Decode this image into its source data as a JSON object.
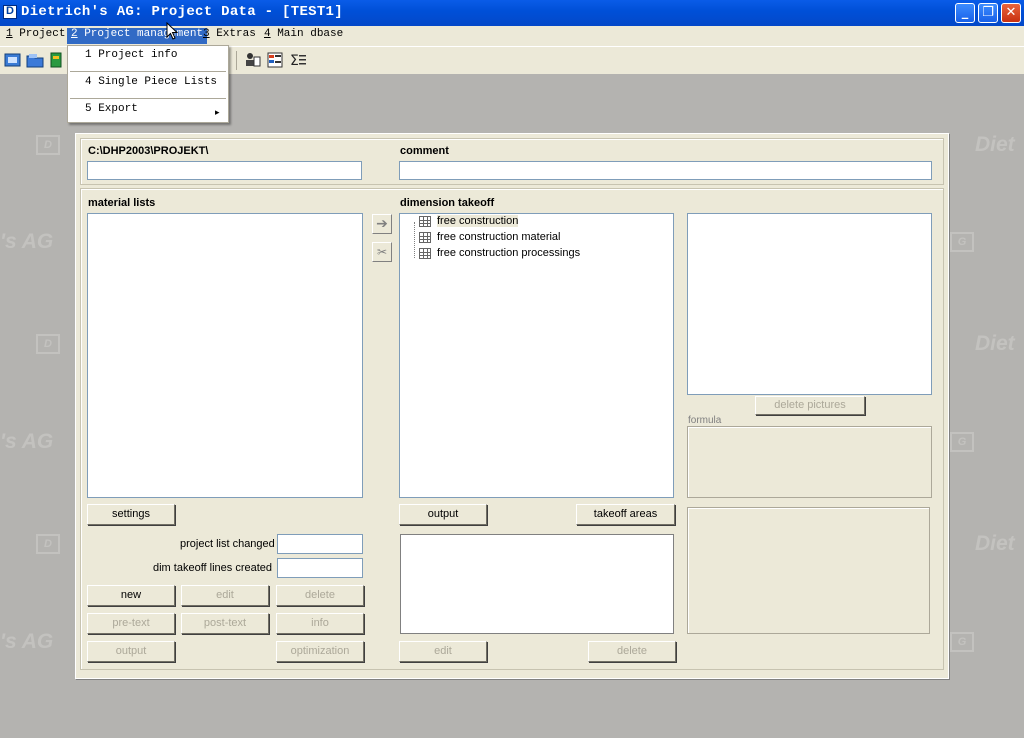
{
  "window": {
    "title": "Dietrich's AG: Project Data - [TEST1]"
  },
  "menubar": {
    "items": [
      {
        "key": "1",
        "label": " Project"
      },
      {
        "key": "2",
        "label": " Project management"
      },
      {
        "key": "3",
        "label": " Extras"
      },
      {
        "key": "4",
        "label": " Main dbase"
      }
    ]
  },
  "dropdown": {
    "items": [
      {
        "label": "1 Project info"
      },
      {
        "label": "4 Single Piece Lists"
      },
      {
        "label": "5 Export",
        "has_submenu": true
      }
    ],
    "submenu_arrow": "▸"
  },
  "watermark": {
    "text_left": "'s AG",
    "text_right": "Diet"
  },
  "header": {
    "path": "C:\\DHP2003\\PROJEKT\\",
    "comment_label": "comment",
    "path_value": "",
    "comment_value": ""
  },
  "material_lists": {
    "label": "material lists",
    "settings_label": "settings",
    "project_list_changed_label": "project list changed",
    "dim_takeoff_lines_label": "dim takeoff lines created",
    "buttons": {
      "new": "new",
      "edit": "edit",
      "delete": "delete",
      "pre_text": "pre-text",
      "post_text": "post-text",
      "info": "info",
      "output": "output",
      "optimization": "optimization"
    }
  },
  "dimension_takeoff": {
    "label": "dimension takeoff",
    "tree": [
      {
        "label": "free construction",
        "selected": true
      },
      {
        "label": "free construction material"
      },
      {
        "label": "free construction processings"
      }
    ],
    "output_label": "output",
    "takeoff_areas_label": "takeoff areas",
    "edit_label": "edit",
    "delete_label": "delete"
  },
  "pictures": {
    "delete_pictures_label": "delete pictures",
    "formula_label": "formula"
  },
  "icons": {
    "transfer": "arrow-right-icon",
    "cut": "scissors-icon"
  }
}
